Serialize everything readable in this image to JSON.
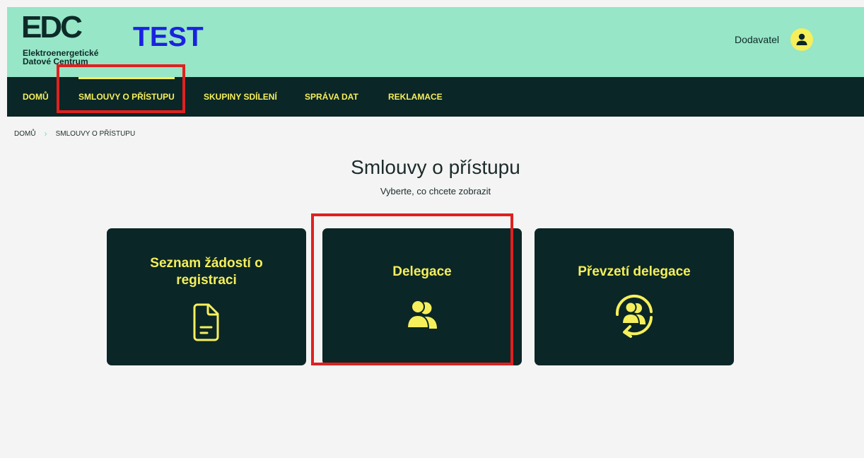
{
  "header": {
    "logo_mark": "EDC",
    "logo_line1": "Elektroenergetické",
    "logo_line2": "Datové Centrum",
    "env_label": "TEST",
    "user_name": "Dodavatel",
    "avatar_icon": "user-icon"
  },
  "nav": {
    "items": [
      {
        "label": "DOMŮ",
        "active": false
      },
      {
        "label": "SMLOUVY O PŘÍSTUPU",
        "active": true
      },
      {
        "label": "SKUPINY SDÍLENÍ",
        "active": false
      },
      {
        "label": "SPRÁVA DAT",
        "active": false
      },
      {
        "label": "REKLAMACE",
        "active": false
      }
    ]
  },
  "breadcrumb": {
    "home": "DOMŮ",
    "current": "SMLOUVY O PŘÍSTUPU"
  },
  "page": {
    "title": "Smlouvy o přístupu",
    "subtitle": "Vyberte, co chcete zobrazit"
  },
  "cards": [
    {
      "title": "Seznam žádostí o registraci",
      "icon": "document-icon"
    },
    {
      "title": "Delegace",
      "icon": "users-icon"
    },
    {
      "title": "Převzetí delegace",
      "icon": "users-cycle-icon"
    }
  ],
  "colors": {
    "header_bg": "#96e6c7",
    "nav_bg": "#0b2626",
    "accent": "#f5ef5c",
    "env_label": "#1a22e0",
    "highlight": "#e02020",
    "page_bg": "#f4f4f4"
  }
}
